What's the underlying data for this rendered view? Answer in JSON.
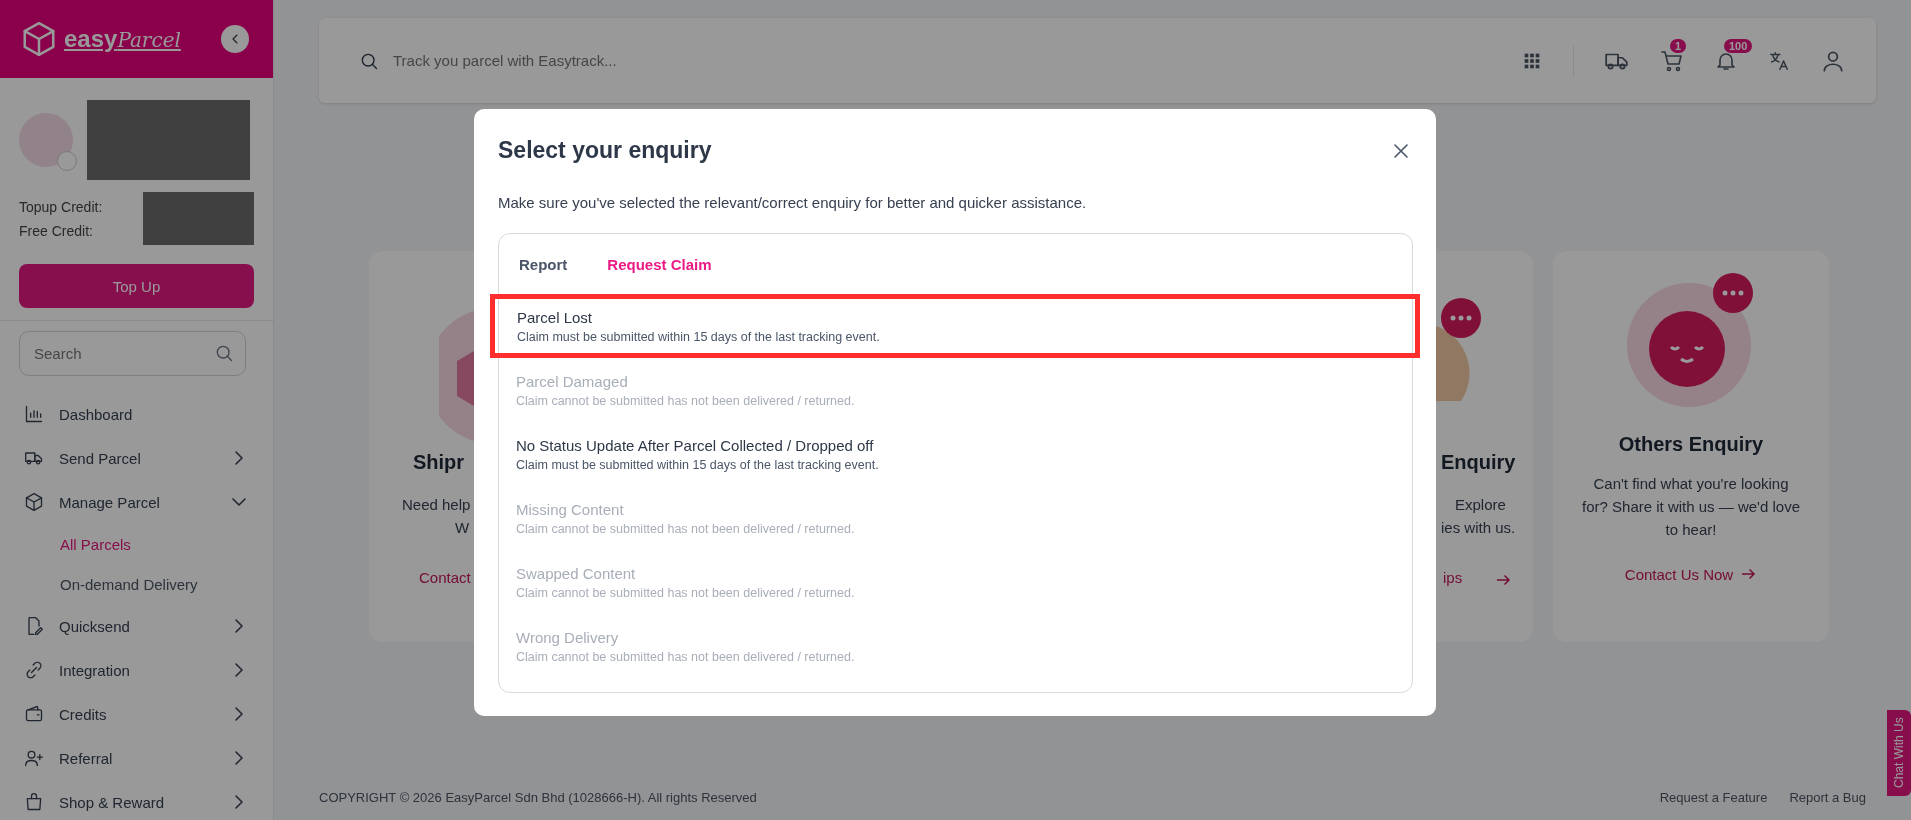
{
  "sidebar": {
    "logo": {
      "text": "easy",
      "script": "Parcel"
    },
    "credits": [
      {
        "label": "Topup Credit:"
      },
      {
        "label": "Free Credit:"
      }
    ],
    "topup_button": "Top Up",
    "search": {
      "placeholder": "Search"
    },
    "nav": [
      {
        "kind": "link",
        "label": "Dashboard"
      },
      {
        "kind": "group",
        "label": "Send Parcel",
        "expanded": false
      },
      {
        "kind": "group",
        "label": "Manage Parcel",
        "expanded": true,
        "children": [
          {
            "label": "All Parcels",
            "selected": true
          },
          {
            "label": "On-demand Delivery",
            "selected": false
          }
        ]
      },
      {
        "kind": "group",
        "label": "Quicksend",
        "expanded": false
      },
      {
        "kind": "group",
        "label": "Integration",
        "expanded": false
      },
      {
        "kind": "group",
        "label": "Credits",
        "expanded": false
      },
      {
        "kind": "group",
        "label": "Referral",
        "expanded": false
      },
      {
        "kind": "group",
        "label": "Shop & Reward",
        "expanded": false
      }
    ]
  },
  "topbar": {
    "search": {
      "placeholder": "Track you parcel with Easytrack..."
    },
    "cart_badge": "1",
    "notification_badge": "100"
  },
  "cards": [
    {
      "title": "Shipr",
      "lines": [
        "Need help",
        "W"
      ],
      "link": "Contact"
    },
    {
      "title": "Enquiry",
      "lines": [
        "Explore",
        "ies with us."
      ],
      "link": "ips"
    },
    {
      "title": "Others Enquiry",
      "lines": [
        "Can't find what you're looking",
        "for? Share it with us — we'd love",
        "to hear!"
      ],
      "link": "Contact Us Now"
    }
  ],
  "footer": {
    "copyright": "COPYRIGHT © 2026 EasyParcel Sdn Bhd (1028666-H). All rights Reserved",
    "links": [
      "Request a Feature",
      "Report a Bug"
    ]
  },
  "chat_tab": "Chat With Us",
  "modal": {
    "title": "Select your enquiry",
    "subtitle": "Make sure you've selected the relevant/correct enquiry for better and quicker assistance.",
    "tabs": [
      {
        "label": "Report",
        "selected": false
      },
      {
        "label": "Request Claim",
        "selected": true
      }
    ],
    "items": [
      {
        "title": "Parcel Lost",
        "note": "Claim must be submitted within 15 days of the last tracking event.",
        "disabled": false,
        "highlighted": true
      },
      {
        "title": "Parcel Damaged",
        "note": "Claim cannot be submitted has not been delivered / returned.",
        "disabled": true,
        "highlighted": false
      },
      {
        "title": "No Status Update After Parcel Collected / Dropped off",
        "note": "Claim must be submitted within 15 days of the last tracking event.",
        "disabled": false,
        "highlighted": false
      },
      {
        "title": "Missing Content",
        "note": "Claim cannot be submitted has not been delivered / returned.",
        "disabled": true,
        "highlighted": false
      },
      {
        "title": "Swapped Content",
        "note": "Claim cannot be submitted has not been delivered / returned.",
        "disabled": true,
        "highlighted": false
      },
      {
        "title": "Wrong Delivery",
        "note": "Claim cannot be submitted has not been delivered / returned.",
        "disabled": true,
        "highlighted": false
      }
    ]
  }
}
